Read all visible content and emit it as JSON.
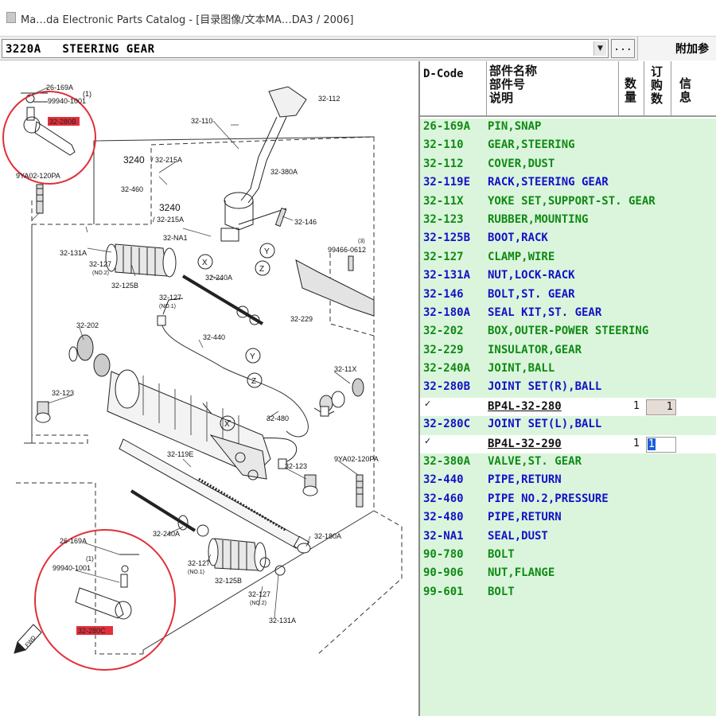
{
  "window": {
    "title": "Ma…da Electronic Parts Catalog - [目录图像/文本MA…DA3 / 2006]"
  },
  "toolbar": {
    "section_value": "3220A   STEERING GEAR",
    "more_label": "...",
    "extra_label": "附加参"
  },
  "diagram": {
    "labels": {
      "l26169A_top": "26-169A",
      "l99940_top": "99940-1001",
      "l1_top": "(1)",
      "l32280B": "32-280B",
      "l9ya02_top": "9YA02-120PA",
      "l32112": "32-112",
      "l32110": "32-110",
      "l3240a": "3240",
      "l32215a_a": "/ 32-215A",
      "l32380a": "32-380A",
      "l32460": "32-460",
      "l3240b": "3240",
      "l32215a_b": "/ 32-215A",
      "l32146": "32-146",
      "l32na1": "32-NA1",
      "l32131a_top": "32-131A",
      "l32127_a": "32-127",
      "l_no2_a": "(NO.2)",
      "l32125b_top": "32-125B",
      "l32240a_top": "32-240A",
      "l99466": "99466-0612",
      "l3_top": "(3)",
      "l32127_b": "32-127",
      "l_no1_a": "(NO.1)",
      "l32229": "32-229",
      "l32202": "32-202",
      "l32440": "32-440",
      "l32123_left": "32-123",
      "l3211x": "32-11X",
      "l32480": "32-480",
      "l32119e": "32-119E",
      "l32123_right": "32-123",
      "l9ya02_right": "9YA02-120PA",
      "l26169A_bot": "26-169A",
      "l1_bot": "(1)",
      "l99940_bot": "99940-1001",
      "l32240a_bot": "32-240A",
      "l32180a": "32-180A",
      "l32127_c": "32-127",
      "l_no1_b": "(NO.1)",
      "l32125b_bot": "32-125B",
      "l32127_d": "32-127",
      "l_no2_b": "(NO.2)",
      "l32131a_bot": "32-131A",
      "l32280c": "32-280C",
      "x_marker": "X",
      "y_marker": "Y",
      "z_marker": "Z",
      "x_marker2": "X",
      "y_marker2": "Y",
      "z_marker2": "Z",
      "fwd": "FWD"
    }
  },
  "parts_list": {
    "headers": {
      "dcode": "D-Code",
      "name_line1": "部件名称",
      "name_line2": "部件号",
      "name_line3": "说明",
      "qty_line1": "数",
      "qty_line2": "量",
      "order_line1": "订",
      "order_line2": "购",
      "order_line3": "数",
      "info_line1": "信",
      "info_line2": "息"
    },
    "rows": [
      {
        "type": "part",
        "code": "26-169A",
        "desc": "PIN,SNAP",
        "color": "norm"
      },
      {
        "type": "part",
        "code": "32-110",
        "desc": "GEAR,STEERING",
        "color": "norm"
      },
      {
        "type": "part",
        "code": "32-112",
        "desc": "COVER,DUST",
        "color": "norm"
      },
      {
        "type": "part",
        "code": "32-119E",
        "desc": "RACK,STEERING GEAR",
        "color": "alt"
      },
      {
        "type": "part",
        "code": "32-11X",
        "desc": "YOKE SET,SUPPORT-ST. GEAR",
        "color": "norm"
      },
      {
        "type": "part",
        "code": "32-123",
        "desc": "RUBBER,MOUNTING",
        "color": "norm"
      },
      {
        "type": "part",
        "code": "32-125B",
        "desc": "BOOT,RACK",
        "color": "alt"
      },
      {
        "type": "part",
        "code": "32-127",
        "desc": "CLAMP,WIRE",
        "color": "norm"
      },
      {
        "type": "part",
        "code": "32-131A",
        "desc": "NUT,LOCK-RACK",
        "color": "alt"
      },
      {
        "type": "part",
        "code": "32-146",
        "desc": "BOLT,ST. GEAR",
        "color": "alt"
      },
      {
        "type": "part",
        "code": "32-180A",
        "desc": "SEAL KIT,ST. GEAR",
        "color": "alt"
      },
      {
        "type": "part",
        "code": "32-202",
        "desc": "BOX,OUTER-POWER STEERING",
        "color": "norm"
      },
      {
        "type": "part",
        "code": "32-229",
        "desc": "INSULATOR,GEAR",
        "color": "norm"
      },
      {
        "type": "part",
        "code": "32-240A",
        "desc": "JOINT,BALL",
        "color": "norm"
      },
      {
        "type": "part",
        "code": "32-280B",
        "desc": "JOINT SET(R),BALL",
        "color": "alt"
      },
      {
        "type": "sub",
        "check": "✓",
        "pn": "BP4L-32-280",
        "qty": "1",
        "order": "1",
        "active": false
      },
      {
        "type": "part",
        "code": "32-280C",
        "desc": "JOINT SET(L),BALL",
        "color": "alt"
      },
      {
        "type": "sub",
        "check": "✓",
        "pn": "BP4L-32-290",
        "qty": "1",
        "order": "1",
        "active": true
      },
      {
        "type": "part",
        "code": "32-380A",
        "desc": "VALVE,ST. GEAR",
        "color": "norm"
      },
      {
        "type": "part",
        "code": "32-440",
        "desc": "PIPE,RETURN",
        "color": "alt"
      },
      {
        "type": "part",
        "code": "32-460",
        "desc": "PIPE NO.2,PRESSURE",
        "color": "alt"
      },
      {
        "type": "part",
        "code": "32-480",
        "desc": "PIPE,RETURN",
        "color": "alt"
      },
      {
        "type": "part",
        "code": "32-NA1",
        "desc": "SEAL,DUST",
        "color": "alt"
      },
      {
        "type": "part",
        "code": "90-780",
        "desc": "BOLT",
        "color": "norm"
      },
      {
        "type": "part",
        "code": "90-906",
        "desc": "NUT,FLANGE",
        "color": "norm"
      },
      {
        "type": "part",
        "code": "99-601",
        "desc": "BOLT",
        "color": "norm"
      }
    ]
  },
  "colors": {
    "row_bg": "#dbf5dc",
    "text_green": "#0f8a14",
    "text_blue": "#1212c8",
    "highlight_red": "#e0303a",
    "selection_blue": "#1e5ed8"
  }
}
